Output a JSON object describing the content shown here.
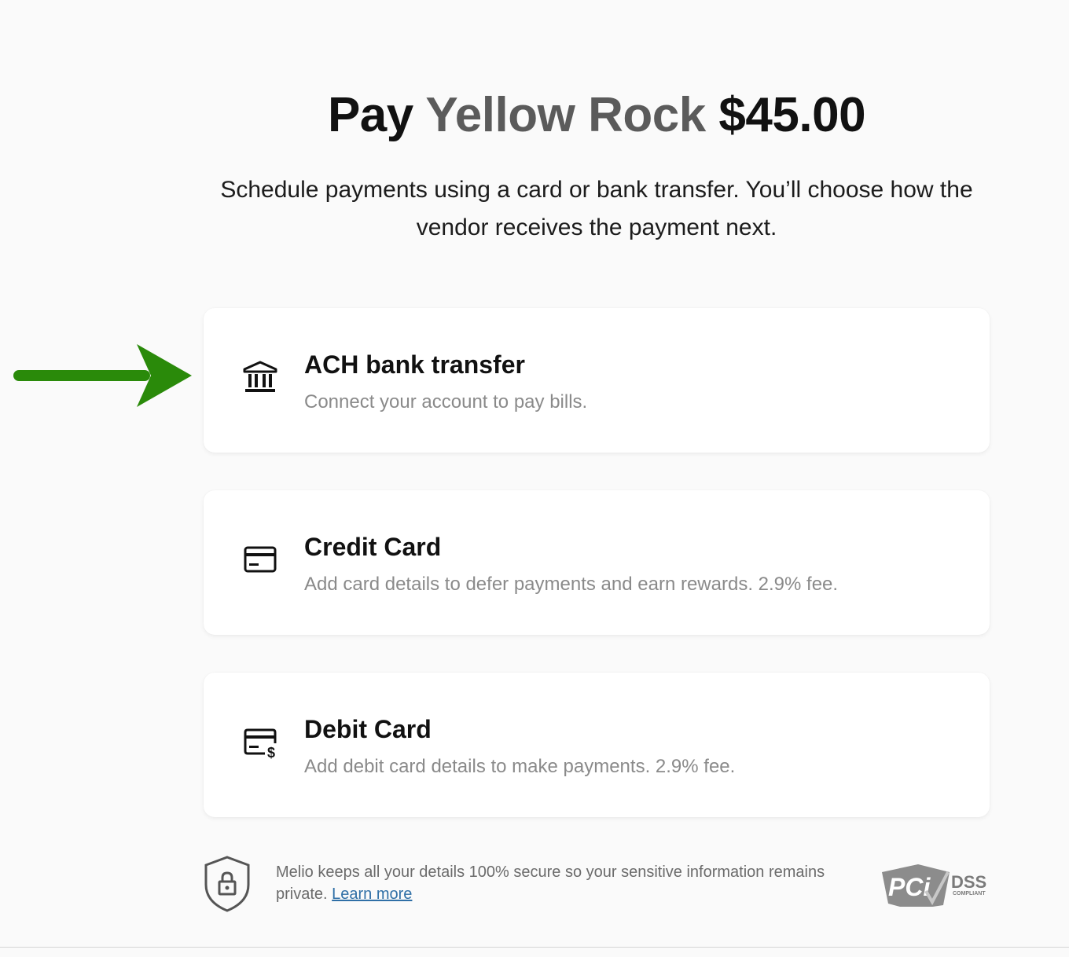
{
  "header": {
    "pay_word": "Pay",
    "vendor_name": "Yellow Rock",
    "amount": "$45.00",
    "subtitle": "Schedule payments using a card or bank transfer. You’ll choose how the vendor receives the payment next."
  },
  "payment_methods": [
    {
      "icon": "bank-icon",
      "title": "ACH bank transfer",
      "description": "Connect your account to pay bills."
    },
    {
      "icon": "credit-card-icon",
      "title": "Credit Card",
      "description": "Add card details to defer payments and earn rewards. 2.9% fee."
    },
    {
      "icon": "debit-card-icon",
      "title": "Debit Card",
      "description": "Add debit card details to make payments. 2.9% fee."
    }
  ],
  "security": {
    "message": "Melio keeps all your details 100% secure so your sensitive information remains private.",
    "link_label": "Learn more",
    "badge_text": "PCi",
    "badge_dss": "DSS",
    "badge_compliant": "COMPLIANT"
  },
  "annotation": {
    "arrow_color": "#2a8a0a"
  }
}
